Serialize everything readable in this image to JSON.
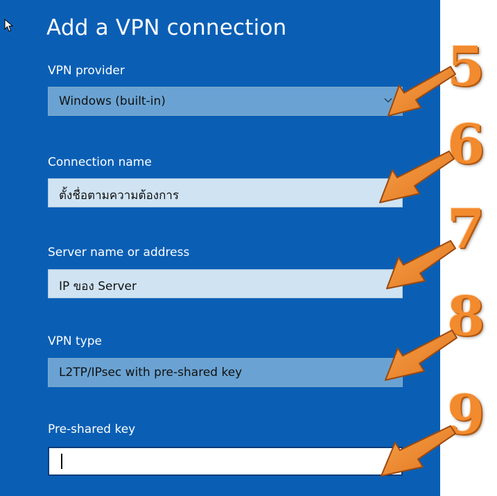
{
  "dialog": {
    "title": "Add a VPN connection"
  },
  "fields": {
    "vpn_provider": {
      "label": "VPN provider",
      "value": "Windows (built-in)"
    },
    "connection_name": {
      "label": "Connection name",
      "value": "ตั้งชื่อตามความต้องการ"
    },
    "server_address": {
      "label": "Server name or address",
      "value": "IP ของ Server"
    },
    "vpn_type": {
      "label": "VPN type",
      "value": "L2TP/IPsec with pre-shared key"
    },
    "pre_shared_key": {
      "label": "Pre-shared key",
      "value": ""
    }
  },
  "annotations": {
    "step_5": "5",
    "step_6": "6",
    "step_7": "7",
    "step_8": "8",
    "step_9": "9"
  },
  "colors": {
    "panel_background": "#0a5fb5",
    "annotation_orange": "#f28a2e"
  },
  "icons": {
    "cursor": "mouse-pointer-icon",
    "dropdown": "chevron-down-icon",
    "annotation_arrow": "arrow-down-left-icon"
  }
}
